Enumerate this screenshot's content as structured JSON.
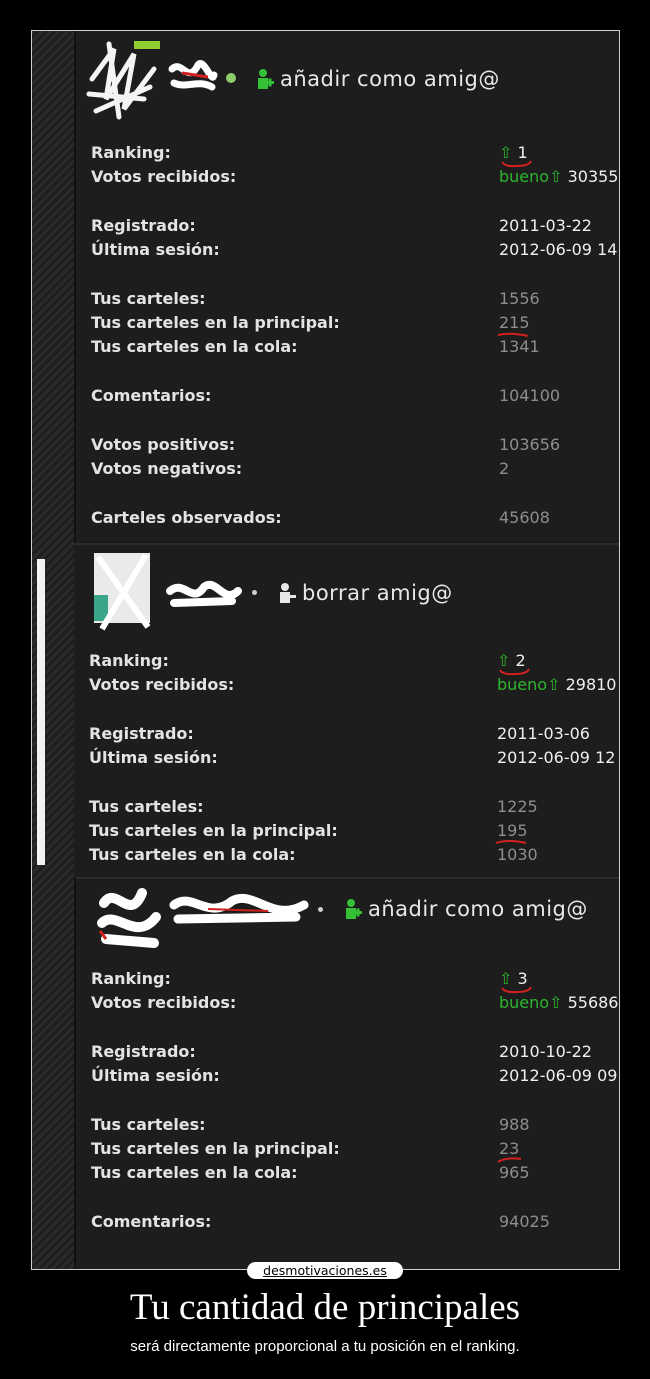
{
  "profiles": [
    {
      "friend_action": "añadir como amig@",
      "ranking": "1",
      "votos_bueno_label": "bueno",
      "votos_recibidos": "30355",
      "registrado": "2011-03-22",
      "ultima_sesion": "2012-06-09 14",
      "tus_carteles": "1556",
      "principal": "215",
      "cola": "1341",
      "comentarios": "104100",
      "votos_positivos": "103656",
      "votos_negativos": "2",
      "carteles_observados": "45608"
    },
    {
      "friend_action": "borrar amig@",
      "ranking": "2",
      "votos_bueno_label": "bueno",
      "votos_recibidos": "29810",
      "registrado": "2011-03-06",
      "ultima_sesion": "2012-06-09 12",
      "tus_carteles": "1225",
      "principal": "195",
      "cola": "1030"
    },
    {
      "friend_action": "añadir como amig@",
      "ranking": "3",
      "votos_bueno_label": "bueno",
      "votos_recibidos": "55686",
      "registrado": "2010-10-22",
      "ultima_sesion": "2012-06-09 09",
      "tus_carteles": "988",
      "principal": "23",
      "cola": "965",
      "comentarios": "94025"
    }
  ],
  "labels": {
    "ranking": "Ranking:",
    "votos_recibidos": "Votos recibidos:",
    "registrado": "Registrado:",
    "ultima_sesion": "Última sesión:",
    "tus_carteles": "Tus carteles:",
    "principal": "Tus carteles en la principal:",
    "cola": "Tus carteles en la cola:",
    "comentarios": "Comentarios:",
    "votos_positivos": "Votos positivos:",
    "votos_negativos": "Votos negativos:",
    "carteles_observados": "Carteles observados:"
  },
  "watermark": "desmotivaciones.es",
  "caption": {
    "title": "Tu cantidad de principales",
    "subtitle": "será directamente proporcional a tu posición en el ranking."
  },
  "colors": {
    "green": "#2db52d",
    "underline_red": "#d22020",
    "value_dim": "#8e8e8e"
  },
  "icons": [
    "user-add-icon",
    "user-remove-icon",
    "arrow-up-icon",
    "online-dot-icon"
  ]
}
